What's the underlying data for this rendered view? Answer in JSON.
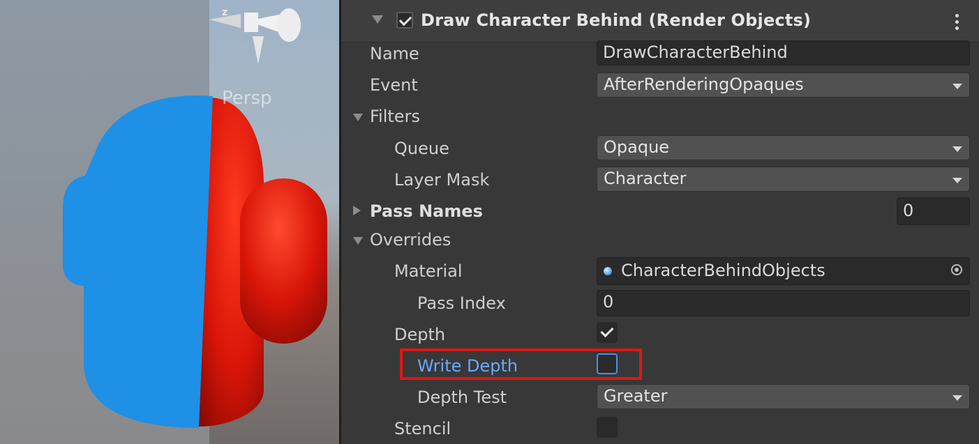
{
  "scene": {
    "persp_label": "Persp",
    "gizmo_axis_label": "z"
  },
  "inspector": {
    "component_title": "Draw Character Behind (Render Objects)",
    "component_enabled": true,
    "rows": {
      "name_label": "Name",
      "name_value": "DrawCharacterBehind",
      "event_label": "Event",
      "event_value": "AfterRenderingOpaques",
      "filters_label": "Filters",
      "queue_label": "Queue",
      "queue_value": "Opaque",
      "layer_mask_label": "Layer Mask",
      "layer_mask_value": "Character",
      "pass_names_label": "Pass Names",
      "pass_names_value": "0",
      "overrides_label": "Overrides",
      "material_label": "Material",
      "material_value": "CharacterBehindObjects",
      "pass_index_label": "Pass Index",
      "pass_index_value": "0",
      "depth_label": "Depth",
      "depth_checked": true,
      "write_depth_label": "Write Depth",
      "write_depth_checked": false,
      "depth_test_label": "Depth Test",
      "depth_test_value": "Greater",
      "stencil_label": "Stencil",
      "stencil_checked": false
    }
  },
  "colors": {
    "panel_bg": "#383838",
    "highlight": "#e01616",
    "hover_label": "#6aa8ff",
    "blue_capsule": "#1e90e6",
    "red_capsule": "#e01a0c"
  },
  "icons": {
    "fold_open": "triangle-down-icon",
    "fold_closed": "triangle-right-icon",
    "material": "material-sphere-icon",
    "object_picker": "object-picker-icon",
    "menu": "kebab-menu-icon"
  }
}
